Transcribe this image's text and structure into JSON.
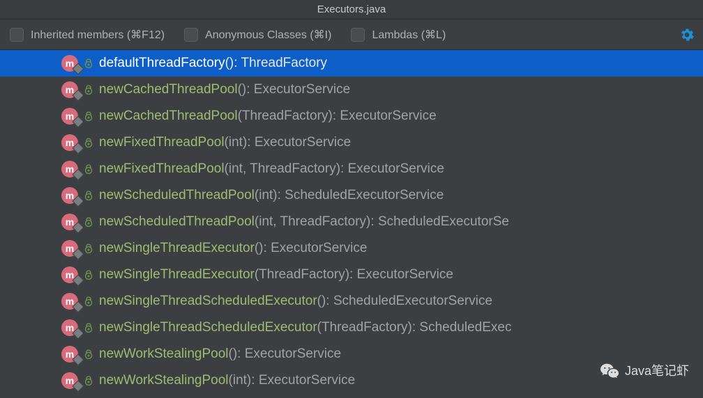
{
  "title": "Executors.java",
  "toolbar": {
    "inherited_label": "Inherited members (⌘F12)",
    "anonymous_label": "Anonymous Classes (⌘I)",
    "lambdas_label": "Lambdas (⌘L)"
  },
  "methods": [
    {
      "name": "defaultThreadFactory",
      "params": "()",
      "return_type": "ThreadFactory",
      "selected": true
    },
    {
      "name": "newCachedThreadPool",
      "params": "()",
      "return_type": "ExecutorService",
      "selected": false
    },
    {
      "name": "newCachedThreadPool",
      "params": "(ThreadFactory)",
      "return_type": "ExecutorService",
      "selected": false
    },
    {
      "name": "newFixedThreadPool",
      "params": "(int)",
      "return_type": "ExecutorService",
      "selected": false
    },
    {
      "name": "newFixedThreadPool",
      "params": "(int, ThreadFactory)",
      "return_type": "ExecutorService",
      "selected": false
    },
    {
      "name": "newScheduledThreadPool",
      "params": "(int)",
      "return_type": "ScheduledExecutorService",
      "selected": false
    },
    {
      "name": "newScheduledThreadPool",
      "params": "(int, ThreadFactory)",
      "return_type": "ScheduledExecutorSe",
      "selected": false
    },
    {
      "name": "newSingleThreadExecutor",
      "params": "()",
      "return_type": "ExecutorService",
      "selected": false
    },
    {
      "name": "newSingleThreadExecutor",
      "params": "(ThreadFactory)",
      "return_type": "ExecutorService",
      "selected": false
    },
    {
      "name": "newSingleThreadScheduledExecutor",
      "params": "()",
      "return_type": "ScheduledExecutorService",
      "selected": false
    },
    {
      "name": "newSingleThreadScheduledExecutor",
      "params": "(ThreadFactory)",
      "return_type": "ScheduledExec",
      "selected": false
    },
    {
      "name": "newWorkStealingPool",
      "params": "()",
      "return_type": "ExecutorService",
      "selected": false
    },
    {
      "name": "newWorkStealingPool",
      "params": "(int)",
      "return_type": "ExecutorService",
      "selected": false
    }
  ],
  "method_icon_letter": "m",
  "watermark": "Java笔记虾"
}
